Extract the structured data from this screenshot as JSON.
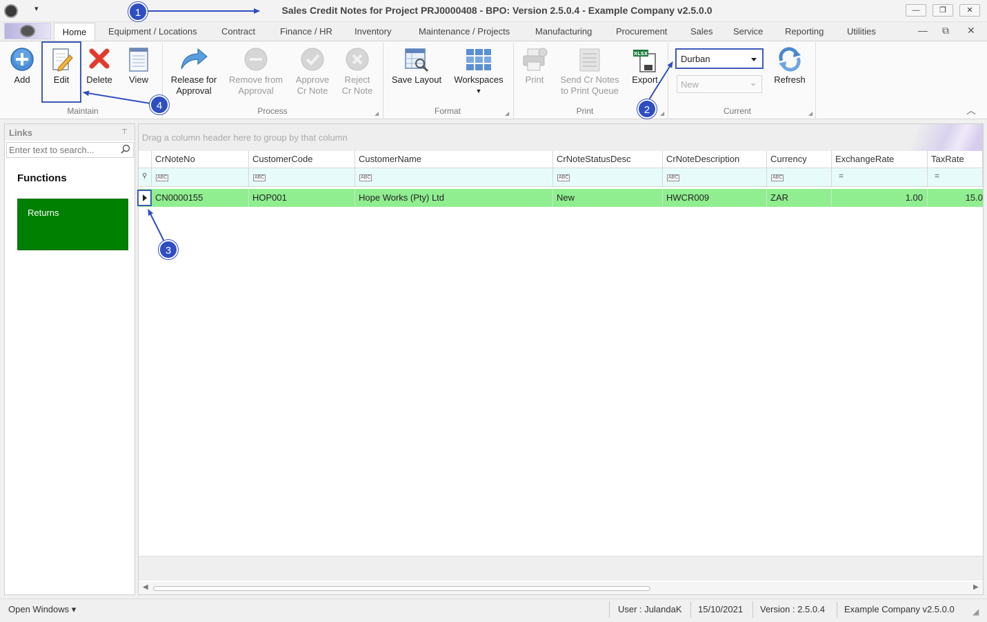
{
  "window": {
    "title": "Sales Credit Notes for Project PRJ0000408 - BPO: Version 2.5.0.4 - Example Company v2.5.0.0",
    "minimize_glyph": "—",
    "restore_glyph": "❐",
    "close_glyph": "✕",
    "qat_glyph": "▾"
  },
  "tabs": [
    {
      "label": "Home"
    },
    {
      "label": "Equipment / Locations"
    },
    {
      "label": "Contract"
    },
    {
      "label": "Finance / HR"
    },
    {
      "label": "Inventory"
    },
    {
      "label": "Maintenance / Projects"
    },
    {
      "label": "Manufacturing"
    },
    {
      "label": "Procurement"
    },
    {
      "label": "Sales"
    },
    {
      "label": "Service"
    },
    {
      "label": "Reporting"
    },
    {
      "label": "Utilities"
    }
  ],
  "mdi": {
    "minimize": "—",
    "restore": "⧉",
    "close": "✕"
  },
  "ribbon": {
    "maintain": {
      "label": "Maintain",
      "add": "Add",
      "edit": "Edit",
      "delete": "Delete",
      "view": "View"
    },
    "process": {
      "label": "Process",
      "release_l1": "Release for",
      "release_l2": "Approval",
      "remove_l1": "Remove from",
      "remove_l2": "Approval",
      "approve_l1": "Approve",
      "approve_l2": "Cr Note",
      "reject_l1": "Reject",
      "reject_l2": "Cr Note"
    },
    "format": {
      "label": "Format",
      "save_layout": "Save Layout",
      "workspaces": "Workspaces"
    },
    "print": {
      "label": "Print",
      "print": "Print",
      "send_l1": "Send Cr Notes",
      "send_l2": "to Print Queue",
      "export": "Export",
      "export_badge": "XLSX"
    },
    "current": {
      "label": "Current",
      "branch": "Durban",
      "status": "New",
      "refresh": "Refresh"
    },
    "collapse_glyph": "︿"
  },
  "links": {
    "header": "Links",
    "pin_glyph": "⊤",
    "search_placeholder": "Enter text to search...",
    "functions_label": "Functions",
    "tile_returns": "Returns"
  },
  "grid": {
    "group_panel_text": "Drag a column header here to group by that column",
    "columns": [
      "CrNoteNo",
      "CustomerCode",
      "CustomerName",
      "CrNoteStatusDesc",
      "CrNoteDescription",
      "Currency",
      "ExchangeRate",
      "TaxRate"
    ],
    "filter_text_glyph": "ABC",
    "filter_num_glyph": "=",
    "filter_row_icon": "⚲",
    "rows": [
      {
        "CrNoteNo": "CN0000155",
        "CustomerCode": "HOP001",
        "CustomerName": "Hope Works (Pty) Ltd",
        "CrNoteStatusDesc": "New",
        "CrNoteDescription": "HWCR009",
        "Currency": "ZAR",
        "ExchangeRate": "1.00",
        "TaxRate": "15.0"
      }
    ]
  },
  "statusbar": {
    "open_windows": "Open Windows ▾",
    "user": "User : JulandaK",
    "date": "15/10/2021",
    "version": "Version : 2.5.0.4",
    "company": "Example Company v2.5.0.0"
  },
  "callouts": [
    "1",
    "2",
    "3",
    "4"
  ],
  "colors": {
    "accent": "#3d5ab8",
    "row_highlight": "#90ee90",
    "tile": "#008000",
    "filter_row": "#e7fbfb"
  }
}
